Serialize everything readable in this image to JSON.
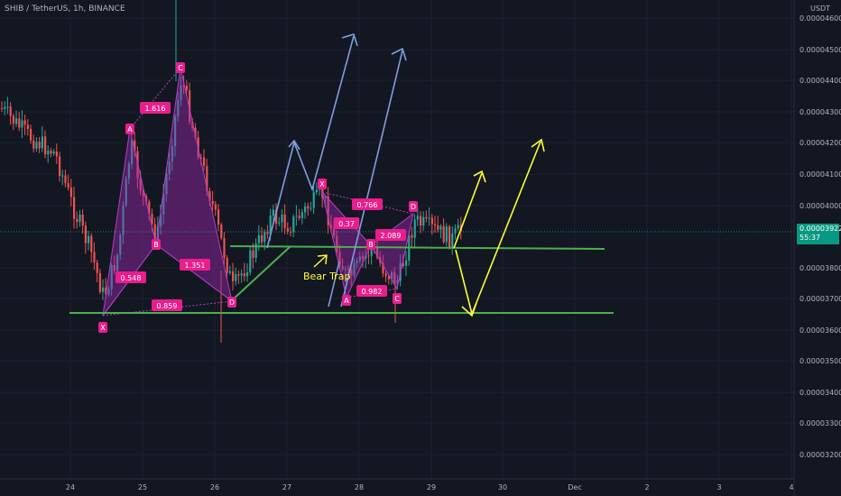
{
  "header": {
    "symbol_title": "SHIB / TetherUS, 1h, BINANCE",
    "currency": "USDT"
  },
  "price_axis": {
    "ticks": [
      "0.00004600",
      "0.00004500",
      "0.00004400",
      "0.00004300",
      "0.00004200",
      "0.00004100",
      "0.00004000",
      "0.00003800",
      "0.00003700",
      "0.00003600",
      "0.00003500",
      "0.00003400",
      "0.00003300",
      "0.00003200"
    ],
    "last_price": "0.00003922",
    "countdown": "55:37"
  },
  "time_axis": {
    "ticks": [
      "24",
      "25",
      "26",
      "27",
      "28",
      "29",
      "30",
      "Dec",
      "2",
      "3",
      "4"
    ]
  },
  "pattern_points": [
    "X",
    "A",
    "B",
    "C",
    "D",
    "X",
    "A",
    "B",
    "C",
    "D"
  ],
  "ratio_labels": [
    "1.616",
    "0.548",
    "1.351",
    "0.859",
    "0.766",
    "0.37",
    "2.089",
    "0.982"
  ],
  "annotation": {
    "bear_trap": "Bear Trap"
  },
  "colors": {
    "background": "#131722",
    "up_candle": "#26a69a",
    "down_candle": "#ef5350",
    "pattern_fill": "#9c27b0",
    "pattern_label": "#e91e8c",
    "support_line": "#4caf50",
    "projection_blue": "#7e9fe0",
    "projection_yellow": "#ffff33",
    "price_tag": "#089981"
  }
}
